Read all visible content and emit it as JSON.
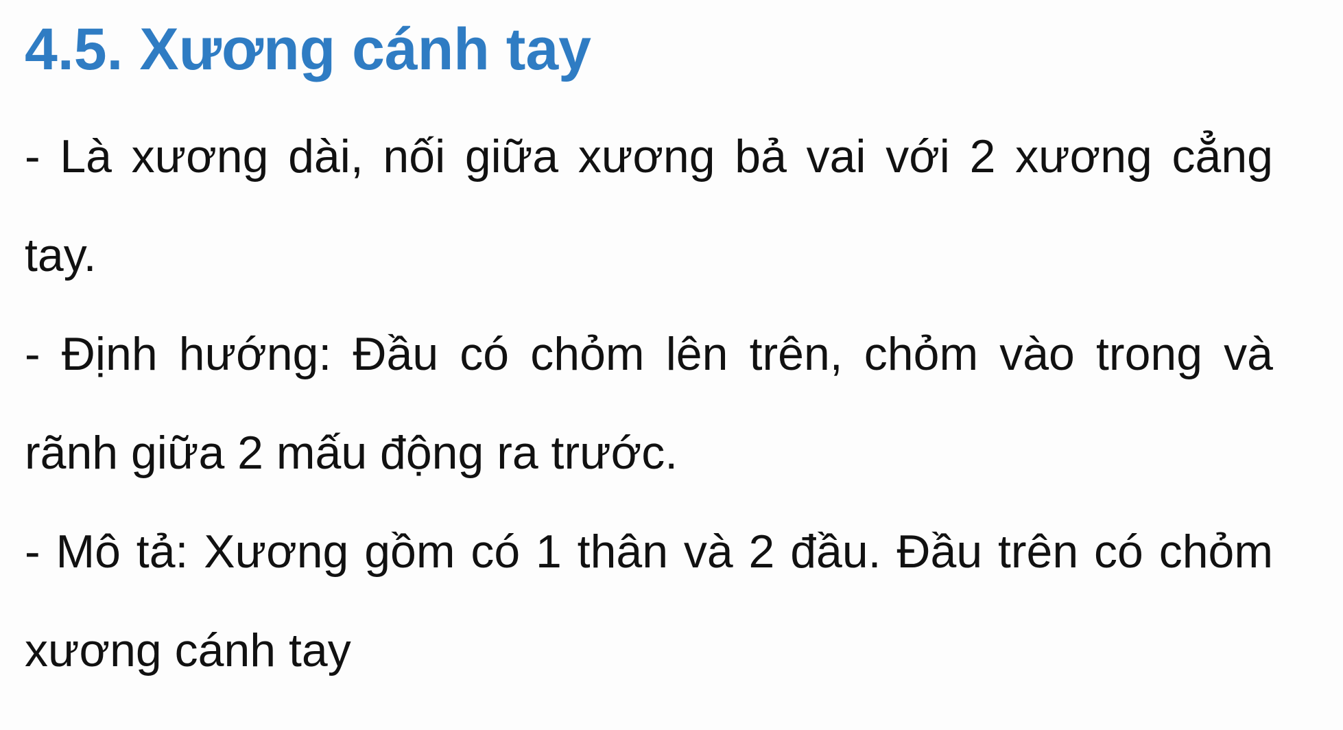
{
  "slide": {
    "title": "4.5. Xương cánh tay",
    "paragraphs": [
      "- Là xương dài, nối giữa xương bả vai với 2 xương cẳng tay.",
      "- Định hướng: Đầu có chỏm lên trên, chỏm vào trong và rãnh giữa 2 mấu động ra trước.",
      "- Mô tả: Xương gồm có 1 thân và 2 đầu. Đầu trên có chỏm xương cánh tay"
    ]
  },
  "colors": {
    "title": "#2f7cc3",
    "body_text": "#111111",
    "background": "#fdfdfd"
  }
}
